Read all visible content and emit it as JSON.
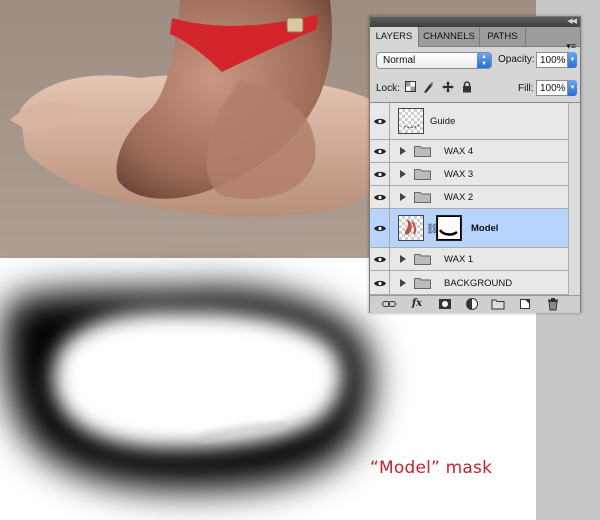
{
  "panel": {
    "collapse_glyph": "◀◀",
    "menu_glyph": "▾≡",
    "tabs": [
      {
        "label": "LAYERS",
        "active": true
      },
      {
        "label": "CHANNELS",
        "active": false
      },
      {
        "label": "PATHS",
        "active": false
      }
    ],
    "blend_mode": "Normal",
    "opacity_label": "Opacity:",
    "opacity_value": "100%",
    "lock_label": "Lock:",
    "fill_label": "Fill:",
    "fill_value": "100%",
    "layers": [
      {
        "name": "Guide",
        "kind": "layer",
        "selected": false,
        "visible": true
      },
      {
        "name": "WAX 4",
        "kind": "group",
        "selected": false,
        "visible": true
      },
      {
        "name": "WAX 3",
        "kind": "group",
        "selected": false,
        "visible": true
      },
      {
        "name": "WAX 2",
        "kind": "group",
        "selected": false,
        "visible": true
      },
      {
        "name": "Model",
        "kind": "layer-with-mask",
        "selected": true,
        "visible": true
      },
      {
        "name": "WAX 1",
        "kind": "group",
        "selected": false,
        "visible": true
      },
      {
        "name": "BACKGROUND",
        "kind": "group",
        "selected": false,
        "visible": true
      }
    ],
    "lock_icons": [
      "lock-transparent-pixels-icon",
      "lock-image-pixels-icon",
      "lock-position-icon",
      "lock-all-icon"
    ],
    "bottom_icons": [
      "link-layers-icon",
      "fx-icon",
      "add-mask-icon",
      "adjustment-layer-icon",
      "new-group-icon",
      "new-layer-icon",
      "trash-icon"
    ],
    "fx_label": "fx",
    "selection_color": "#b6d4fd"
  },
  "caption": "“Model” mask",
  "caption_color": "#c8202a"
}
